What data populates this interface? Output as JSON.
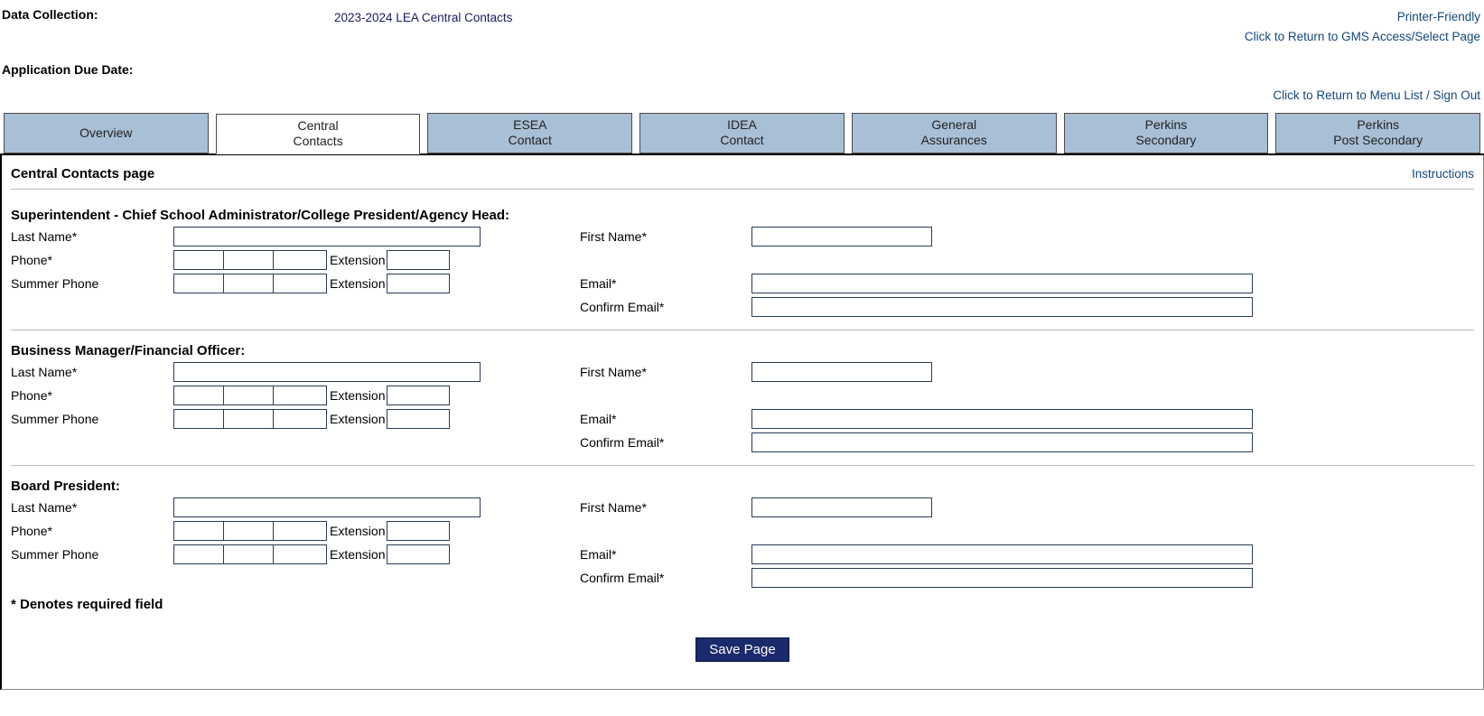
{
  "header": {
    "data_collection_label": "Data Collection:",
    "data_collection_value": "2023-2024 LEA Central Contacts",
    "due_date_label": "Application Due Date:",
    "links": {
      "printer_friendly": "Printer-Friendly",
      "return_gms": "Click to Return to GMS Access/Select Page",
      "return_menu": "Click to Return to Menu List / Sign Out"
    }
  },
  "tabs": [
    {
      "label": "Overview",
      "active": false
    },
    {
      "label": "Central\nContacts",
      "active": true
    },
    {
      "label": "ESEA\nContact",
      "active": false
    },
    {
      "label": "IDEA\nContact",
      "active": false
    },
    {
      "label": "General\nAssurances",
      "active": false
    },
    {
      "label": "Perkins\nSecondary",
      "active": false
    },
    {
      "label": "Perkins\nPost Secondary",
      "active": false
    }
  ],
  "page": {
    "title": "Central Contacts page",
    "instructions_link": "Instructions",
    "required_note": "* Denotes required field",
    "save_button": "Save Page"
  },
  "labels": {
    "last_name": "Last Name*",
    "first_name": "First Name*",
    "phone": "Phone*",
    "summer_phone": "Summer Phone",
    "extension": "Extension",
    "email": "Email*",
    "confirm_email": "Confirm Email*"
  },
  "sections": [
    {
      "heading": "Superintendent - Chief School Administrator/College President/Agency Head:",
      "last_name": "",
      "first_name": "",
      "phone": {
        "p1": "",
        "p2": "",
        "p3": "",
        "ext": ""
      },
      "summer_phone": {
        "p1": "",
        "p2": "",
        "p3": "",
        "ext": ""
      },
      "email": "",
      "confirm_email": ""
    },
    {
      "heading": "Business Manager/Financial Officer:",
      "last_name": "",
      "first_name": "",
      "phone": {
        "p1": "",
        "p2": "",
        "p3": "",
        "ext": ""
      },
      "summer_phone": {
        "p1": "",
        "p2": "",
        "p3": "",
        "ext": ""
      },
      "email": "",
      "confirm_email": ""
    },
    {
      "heading": "Board President:",
      "last_name": "",
      "first_name": "",
      "phone": {
        "p1": "",
        "p2": "",
        "p3": "",
        "ext": ""
      },
      "summer_phone": {
        "p1": "",
        "p2": "",
        "p3": "",
        "ext": ""
      },
      "email": "",
      "confirm_email": ""
    }
  ]
}
